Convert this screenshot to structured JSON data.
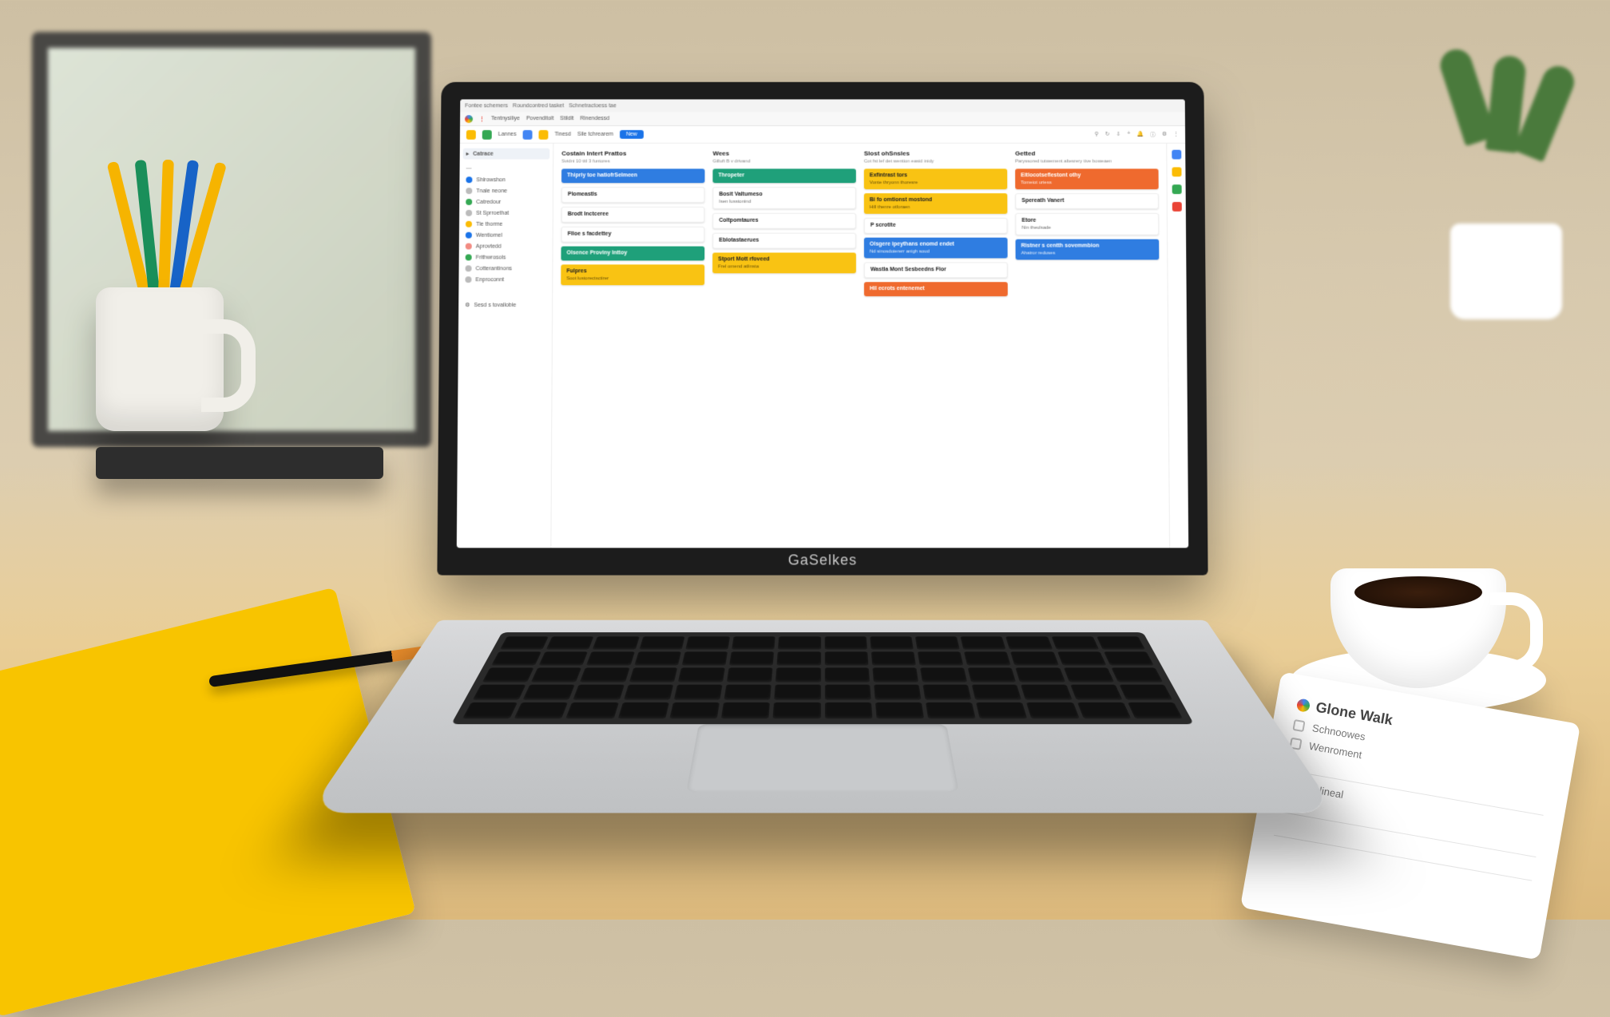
{
  "scene": {
    "laptop_brand": "GaSelkes",
    "note_card": {
      "title": "Glone Walk",
      "items": [
        "Schnoowes",
        "Wenroment",
        "Pyt lineal"
      ]
    }
  },
  "titlebar": {
    "tab1": "Fontee schemers",
    "tab2": "Roundcontred tasket",
    "tab3": "Schnetractoess tae"
  },
  "tabbar": {
    "item1": "Tentnysiliye",
    "item2": "Povenditolt",
    "item3": "Stildlt",
    "item4": "Rinendessd"
  },
  "toolbar": {
    "btn1": "Lannes",
    "btn2": "Tinesd",
    "btn3": "Sile tchrearem",
    "active": "New"
  },
  "sidebar": {
    "search_sel": "Catrace",
    "items": [
      {
        "label": "Shlrowshon",
        "color": "#1a73e8"
      },
      {
        "label": "Tnale neone",
        "color": "#999"
      },
      {
        "label": "Catredour",
        "color": "#34a853"
      },
      {
        "label": "St Sprroethat",
        "color": "#999"
      },
      {
        "label": "Tle thorme",
        "color": "#fbbc05"
      },
      {
        "label": "Wentiomel",
        "color": "#1a73e8"
      },
      {
        "label": "Aprovtedd",
        "color": "#f28b82"
      },
      {
        "label": "Frithwrosols",
        "color": "#34a853"
      },
      {
        "label": "Cotterantinons",
        "color": "#999"
      },
      {
        "label": "Enproconnt",
        "color": "#999"
      }
    ],
    "footer": "Sesd s tovalloble"
  },
  "board": {
    "columns": [
      {
        "title": "Costain Intert Prattos",
        "sub": "Svidni 10 titl 3 funtores",
        "cards": [
          {
            "color": "blue",
            "t": "Thipriy toe hatiofrSelmeen",
            "s": ""
          },
          {
            "color": "white",
            "t": "Plomeastls",
            "s": ""
          },
          {
            "color": "white",
            "t": "Brodt Inctceree",
            "s": ""
          },
          {
            "color": "white",
            "t": "Flloe s facdettey",
            "s": ""
          },
          {
            "color": "green",
            "t": "Olsence Proviny Inttoy",
            "s": ""
          },
          {
            "color": "yellow",
            "t": "Fulpres",
            "s": "Soot lustorectsctirer"
          }
        ]
      },
      {
        "title": "Wees",
        "sub": "Gilluft B v drivand",
        "cards": [
          {
            "color": "green",
            "t": "Thropeter",
            "s": ""
          },
          {
            "color": "white",
            "t": "Bosit Valtumeso",
            "s": "Isen lusstonind"
          },
          {
            "color": "white",
            "t": "Coltpomtaures",
            "s": ""
          },
          {
            "color": "white",
            "t": "Eblotastaerues",
            "s": ""
          },
          {
            "color": "yellow",
            "t": "Stport Mott rfoveed",
            "s": "Frel omend atlinsta"
          }
        ]
      },
      {
        "title": "Slost ohSnsles",
        "sub": "Cot fst lef det wention easid inidy",
        "cards": [
          {
            "color": "yellow",
            "t": "Exfintrast tors",
            "s": "Vonte thryonn thoresre"
          },
          {
            "color": "yellow",
            "t": "Bi fo omtionst mostond",
            "s": "Hill thenre otforaen"
          },
          {
            "color": "white",
            "t": "P scrotite",
            "s": ""
          },
          {
            "color": "blue",
            "t": "Olsgere ipeythans enomd endet",
            "s": "Nd sinosdoiererr anigh soud"
          },
          {
            "color": "white",
            "t": "Wastla Mont Sesbeedns Flor",
            "s": ""
          },
          {
            "color": "orange",
            "t": "Hil ecrots entenemet",
            "s": ""
          }
        ]
      },
      {
        "title": "Getted",
        "sub": "Paryssored tutwement altesrery tive boweaen",
        "cards": [
          {
            "color": "orange",
            "t": "Eitlocotseflestont othy",
            "s": "Tomeiot uriess"
          },
          {
            "color": "white",
            "t": "Spereath Vanert",
            "s": ""
          },
          {
            "color": "white",
            "t": "Etore",
            "s": "Nin theulsade"
          },
          {
            "color": "blue",
            "t": "Ristner s centth sovemmbion",
            "s": "Ahatror reduses"
          }
        ]
      }
    ]
  }
}
